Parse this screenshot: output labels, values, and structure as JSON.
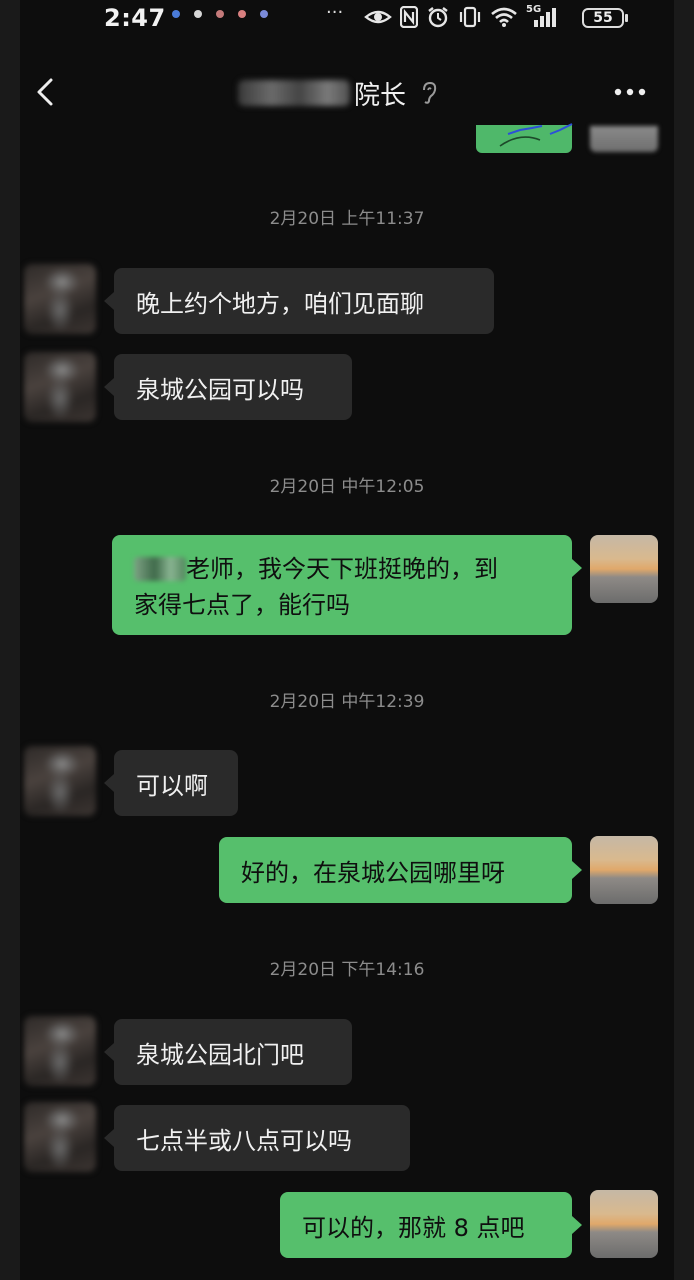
{
  "status_bar": {
    "time": "2:47",
    "more": "···",
    "network": "5G",
    "battery": "55"
  },
  "header": {
    "title_visible": "院长",
    "back_icon": "chevron-left-icon",
    "more_icon": "more-horizontal-icon",
    "ear_icon": "ear-icon"
  },
  "chat": {
    "timestamps": [
      "2月20日 上午11:37",
      "2月20日 中午12:05",
      "2月20日 中午12:39",
      "2月20日 下午14:16"
    ],
    "messages": [
      {
        "side": "left",
        "text": "晚上约个地方，咱们见面聊"
      },
      {
        "side": "left",
        "text": "泉城公园可以吗"
      },
      {
        "side": "right",
        "line1": "老师，我今天下班挺晚的，到",
        "line2": "家得七点了，能行吗"
      },
      {
        "side": "left",
        "text": "可以啊"
      },
      {
        "side": "right",
        "text": "好的，在泉城公园哪里呀"
      },
      {
        "side": "left",
        "text": "泉城公园北门吧"
      },
      {
        "side": "left",
        "text": "七点半或八点可以吗"
      },
      {
        "side": "right",
        "text": "可以的，那就 8 点吧"
      }
    ]
  },
  "colors": {
    "background": "#0d0d0d",
    "outgoing_bubble": "#56bf6c",
    "incoming_bubble": "#2a2a2a",
    "timestamp_text": "#8c8c8c"
  }
}
